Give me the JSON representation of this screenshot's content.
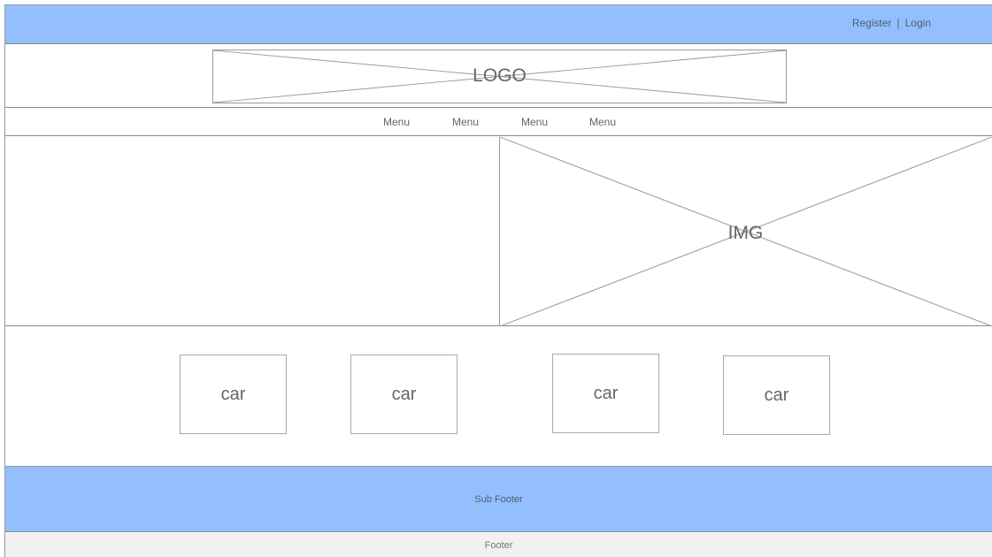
{
  "header": {
    "register_label": "Register",
    "separator": "|",
    "login_label": "Login"
  },
  "logo": {
    "label": "LOGO"
  },
  "nav": {
    "items": [
      {
        "label": "Menu"
      },
      {
        "label": "Menu"
      },
      {
        "label": "Menu"
      },
      {
        "label": "Menu"
      }
    ]
  },
  "hero": {
    "image_label": "IMG"
  },
  "cars": [
    {
      "label": "car"
    },
    {
      "label": "car"
    },
    {
      "label": "car"
    },
    {
      "label": "car"
    }
  ],
  "subfooter": {
    "label": "Sub Footer"
  },
  "footer": {
    "label": "Footer"
  },
  "colors": {
    "bar_blue": "#93bffe",
    "footer_gray": "#f1f1f1",
    "line_gray": "#9a9a9a"
  }
}
